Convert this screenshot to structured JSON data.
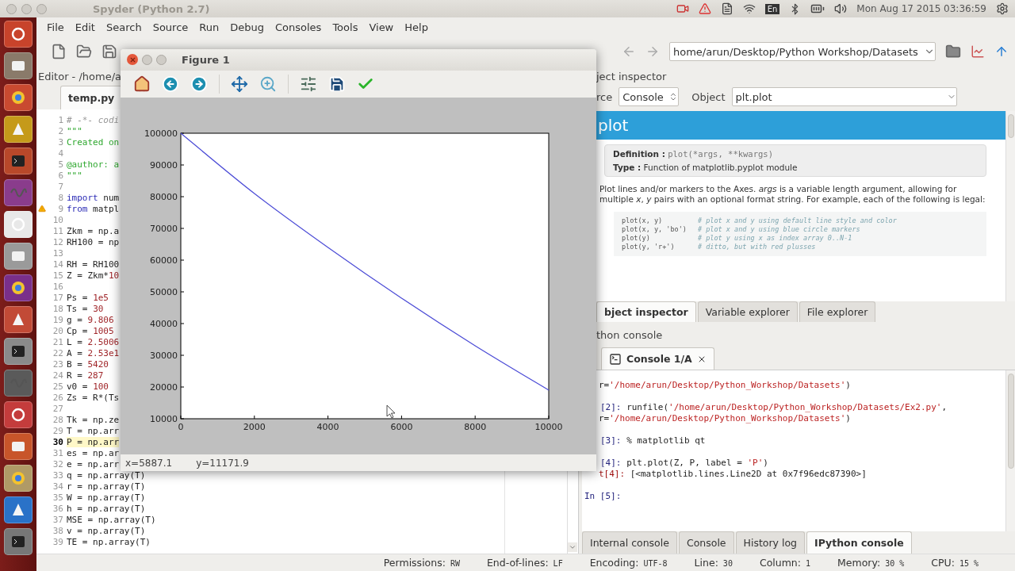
{
  "desktop_bar": {
    "window_title": "Spyder (Python 2.7)",
    "keyboard_layout": "En",
    "clock": "Mon Aug 17 2015 03:36:59"
  },
  "menu": [
    "File",
    "Edit",
    "Search",
    "Source",
    "Run",
    "Debug",
    "Consoles",
    "Tools",
    "View",
    "Help"
  ],
  "path_combo": {
    "value": "home/arun/Desktop/Python  Workshop/Datasets"
  },
  "editor": {
    "title": "Editor - /home/a",
    "tabs": [
      {
        "label": "temp.py",
        "selected": true
      }
    ],
    "lines": [
      {
        "number": "1",
        "segments": [
          {
            "t": "# -*- codi",
            "kind": "comment"
          }
        ],
        "current": false,
        "warning": false
      },
      {
        "number": "2",
        "segments": [
          {
            "t": "\"\"\"",
            "kind": "doc"
          }
        ],
        "current": false,
        "warning": false
      },
      {
        "number": "3",
        "segments": [
          {
            "t": "Created on",
            "kind": "doc"
          }
        ],
        "current": false,
        "warning": false
      },
      {
        "number": "4",
        "current": false,
        "warning": false
      },
      {
        "number": "5",
        "segments": [
          {
            "t": "@author: a",
            "kind": "doc"
          }
        ],
        "current": false,
        "warning": false
      },
      {
        "number": "6",
        "segments": [
          {
            "t": "\"\"\"",
            "kind": "doc"
          }
        ],
        "current": false,
        "warning": false
      },
      {
        "number": "7",
        "current": false,
        "warning": false
      },
      {
        "number": "8",
        "segments": [
          {
            "t": "import",
            "kind": "kw"
          },
          {
            "t": " num",
            "kind": "code"
          }
        ],
        "current": false,
        "warning": false
      },
      {
        "number": "9",
        "segments": [
          {
            "t": "from",
            "kind": "kw"
          },
          {
            "t": " matpl",
            "kind": "code"
          }
        ],
        "current": false,
        "warning": true
      },
      {
        "number": "10",
        "current": false,
        "warning": false
      },
      {
        "number": "11",
        "segments": [
          {
            "t": "Zkm = np.a",
            "kind": "code"
          }
        ],
        "current": false,
        "warning": false
      },
      {
        "number": "12",
        "segments": [
          {
            "t": "RH100 = np",
            "kind": "code"
          }
        ],
        "current": false,
        "warning": false
      },
      {
        "number": "13",
        "current": false,
        "warning": false
      },
      {
        "number": "14",
        "segments": [
          {
            "t": "RH = RH100",
            "kind": "code"
          }
        ],
        "current": false,
        "warning": false
      },
      {
        "number": "15",
        "segments": [
          {
            "t": "Z = Zkm*",
            "kind": "code"
          },
          {
            "t": "10",
            "kind": "num"
          }
        ],
        "current": false,
        "warning": false
      },
      {
        "number": "16",
        "current": false,
        "warning": false
      },
      {
        "number": "17",
        "segments": [
          {
            "t": "Ps = ",
            "kind": "code"
          },
          {
            "t": "1e5",
            "kind": "num"
          }
        ],
        "current": false,
        "warning": false
      },
      {
        "number": "18",
        "segments": [
          {
            "t": "Ts = ",
            "kind": "code"
          },
          {
            "t": "30",
            "kind": "num"
          }
        ],
        "current": false,
        "warning": false
      },
      {
        "number": "19",
        "segments": [
          {
            "t": "g = ",
            "kind": "code"
          },
          {
            "t": "9.806",
            "kind": "num"
          }
        ],
        "current": false,
        "warning": false
      },
      {
        "number": "20",
        "segments": [
          {
            "t": "Cp = ",
            "kind": "code"
          },
          {
            "t": "1005",
            "kind": "num"
          }
        ],
        "current": false,
        "warning": false
      },
      {
        "number": "21",
        "segments": [
          {
            "t": "L = ",
            "kind": "code"
          },
          {
            "t": "2.5006",
            "kind": "num"
          }
        ],
        "current": false,
        "warning": false
      },
      {
        "number": "22",
        "segments": [
          {
            "t": "A = ",
            "kind": "code"
          },
          {
            "t": "2.53e1",
            "kind": "num"
          }
        ],
        "current": false,
        "warning": false
      },
      {
        "number": "23",
        "segments": [
          {
            "t": "B = ",
            "kind": "code"
          },
          {
            "t": "5420",
            "kind": "num"
          }
        ],
        "current": false,
        "warning": false
      },
      {
        "number": "24",
        "segments": [
          {
            "t": "R = ",
            "kind": "code"
          },
          {
            "t": "287",
            "kind": "num"
          }
        ],
        "current": false,
        "warning": false
      },
      {
        "number": "25",
        "segments": [
          {
            "t": "v0 = ",
            "kind": "code"
          },
          {
            "t": "100",
            "kind": "num"
          }
        ],
        "current": false,
        "warning": false
      },
      {
        "number": "26",
        "segments": [
          {
            "t": "Zs = R*(Ts",
            "kind": "code"
          }
        ],
        "current": false,
        "warning": false
      },
      {
        "number": "27",
        "current": false,
        "warning": false
      },
      {
        "number": "28",
        "segments": [
          {
            "t": "Tk = np.ze",
            "kind": "code"
          }
        ],
        "current": false,
        "warning": false
      },
      {
        "number": "29",
        "segments": [
          {
            "t": "T = np.arr",
            "kind": "code"
          }
        ],
        "current": false,
        "warning": false
      },
      {
        "number": "30",
        "segments": [
          {
            "t": "P = np.arr",
            "kind": "code"
          }
        ],
        "current": true,
        "warning": false
      },
      {
        "number": "31",
        "segments": [
          {
            "t": "es = np.ar",
            "kind": "code"
          }
        ],
        "current": false,
        "warning": false
      },
      {
        "number": "32",
        "segments": [
          {
            "t": "e = np.arr",
            "kind": "code"
          }
        ],
        "current": false,
        "warning": false
      },
      {
        "number": "33",
        "segments": [
          {
            "t": "q = np.array(T)",
            "kind": "code"
          }
        ],
        "current": false,
        "warning": false
      },
      {
        "number": "34",
        "segments": [
          {
            "t": "r = np.array(T)",
            "kind": "code"
          }
        ],
        "current": false,
        "warning": false
      },
      {
        "number": "35",
        "segments": [
          {
            "t": "W = np.array(T)",
            "kind": "code"
          }
        ],
        "current": false,
        "warning": false
      },
      {
        "number": "36",
        "segments": [
          {
            "t": "h = np.array(T)",
            "kind": "code"
          }
        ],
        "current": false,
        "warning": false
      },
      {
        "number": "37",
        "segments": [
          {
            "t": "MSE = np.array(T)",
            "kind": "code"
          }
        ],
        "current": false,
        "warning": false
      },
      {
        "number": "38",
        "segments": [
          {
            "t": "v = np.array(T)",
            "kind": "code"
          }
        ],
        "current": false,
        "warning": false
      },
      {
        "number": "39",
        "segments": [
          {
            "t": "TE = np.array(T)",
            "kind": "code"
          }
        ],
        "current": false,
        "warning": false
      }
    ]
  },
  "object_inspector": {
    "title": "ject inspector",
    "source_label": "rce",
    "source": "Console",
    "object_label": "Object",
    "object": "plt.plot",
    "heading": "plot",
    "definition": {
      "label": "Definition :",
      "value": "plot(*args, **kwargs)"
    },
    "type": {
      "label": "Type :",
      "value": "Function of matplotlib.pyplot module"
    },
    "description": "Plot lines and/or markers to the Axes. *args* is a variable length argument, allowing for multiple *x*, *y* pairs with an optional format string. For example, each of the following is legal:",
    "examples": [
      {
        "code": "plot(x, y)",
        "comment": "# plot x and y using default line style and color"
      },
      {
        "code": "plot(x, y, 'bo')",
        "comment": "# plot x and y using blue circle markers"
      },
      {
        "code": "plot(y)",
        "comment": "# plot y using x as index array 0..N-1"
      },
      {
        "code": "plot(y, 'r+')",
        "comment": "# ditto, but with red plusses"
      }
    ]
  },
  "right_tabs": [
    {
      "label": "bject inspector",
      "selected": true
    },
    {
      "label": "Variable explorer",
      "selected": false
    },
    {
      "label": "File explorer",
      "selected": false
    }
  ],
  "console": {
    "title": "thon console",
    "tabs": [
      {
        "label": "Console 1/A",
        "selected": true
      }
    ],
    "blocks": [
      [
        {
          "kind": "continuation",
          "segments": [
            {
              "t": "r=",
              "kind": "code"
            },
            {
              "t": "'/home/arun/Desktop/Python_Workshop/Datasets'",
              "kind": "string"
            },
            {
              "t": ")",
              "kind": "code"
            }
          ]
        }
      ],
      [
        {
          "kind": "input",
          "segments": [
            {
              "t": "[2]: ",
              "kind": "prompt"
            },
            {
              "t": "runfile(",
              "kind": "code"
            },
            {
              "t": "'/home/arun/Desktop/Python_Workshop/Datasets/Ex2.py'",
              "kind": "string"
            },
            {
              "t": ",",
              "kind": "code"
            }
          ]
        },
        {
          "kind": "continuation",
          "segments": [
            {
              "t": "r=",
              "kind": "code"
            },
            {
              "t": "'/home/arun/Desktop/Python_Workshop/Datasets'",
              "kind": "string"
            },
            {
              "t": ")",
              "kind": "code"
            }
          ]
        }
      ],
      [
        {
          "kind": "input",
          "segments": [
            {
              "t": "[3]: ",
              "kind": "prompt"
            },
            {
              "t": "% matplotlib qt",
              "kind": "code"
            }
          ]
        }
      ],
      [
        {
          "kind": "input",
          "segments": [
            {
              "t": "[4]: ",
              "kind": "prompt"
            },
            {
              "t": "plt.plot(Z, P, label = ",
              "kind": "code"
            },
            {
              "t": "'P'",
              "kind": "string"
            },
            {
              "t": ")",
              "kind": "code"
            }
          ]
        },
        {
          "kind": "output",
          "segments": [
            {
              "t": "t[4]: ",
              "kind": "out"
            },
            {
              "t": "[<matplotlib.lines.Line2D at 0x7f96edc87390>]",
              "kind": "code"
            }
          ]
        }
      ],
      [
        {
          "kind": "prompt",
          "segments": [
            {
              "t": "In [5]:",
              "kind": "prompt"
            }
          ]
        }
      ]
    ]
  },
  "console_tabs": [
    {
      "label": "Internal console",
      "selected": false
    },
    {
      "label": "Console",
      "selected": false
    },
    {
      "label": "History log",
      "selected": false
    },
    {
      "label": "IPython console",
      "selected": true
    }
  ],
  "status_bar": [
    {
      "label": "Permissions:",
      "value": "RW"
    },
    {
      "label": "End-of-lines:",
      "value": "LF"
    },
    {
      "label": "Encoding:",
      "value": "UTF-8"
    },
    {
      "label": "Line:",
      "value": "30"
    },
    {
      "label": "Column:",
      "value": "1"
    },
    {
      "label": "Memory:",
      "value": "30 %"
    },
    {
      "label": "CPU:",
      "value": "15 %"
    }
  ],
  "figure": {
    "title": "Figure 1",
    "status": [
      "x=5887.1",
      "y=11171.9"
    ],
    "chart_data": {
      "type": "line",
      "x": [
        0,
        2000,
        4000,
        6000,
        8000,
        10000
      ],
      "series": [
        {
          "color": "#4b4bd6",
          "values": [
            100000,
            81000,
            64000,
            48000,
            33000,
            19000
          ]
        }
      ],
      "xlim": [
        0,
        10000
      ],
      "ylim": [
        10000,
        100000
      ],
      "xticks": [
        0,
        2000,
        4000,
        6000,
        8000,
        10000
      ],
      "yticks": [
        10000,
        20000,
        30000,
        40000,
        50000,
        60000,
        70000,
        80000,
        90000,
        100000
      ]
    }
  }
}
